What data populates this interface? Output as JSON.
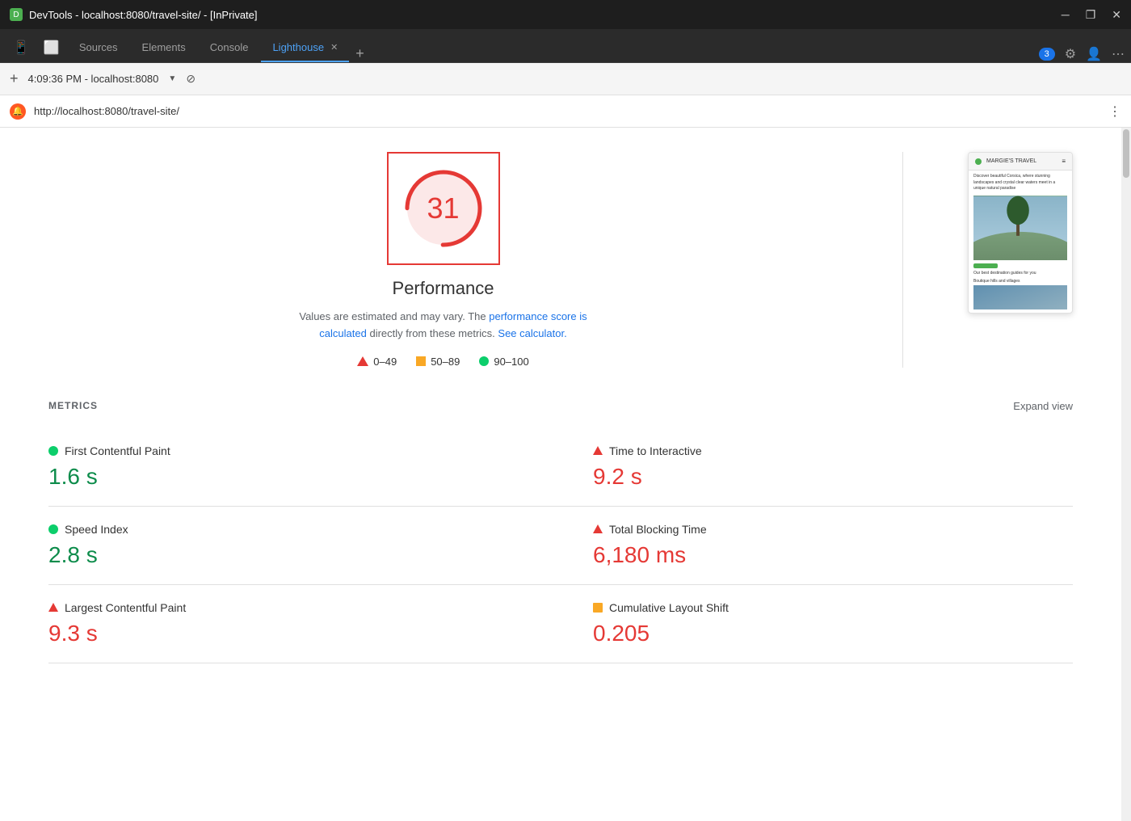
{
  "titleBar": {
    "title": "DevTools - localhost:8080/travel-site/ - [InPrivate]",
    "iconLabel": "D"
  },
  "tabs": {
    "items": [
      {
        "id": "sources",
        "label": "Sources",
        "active": false,
        "closable": false
      },
      {
        "id": "elements",
        "label": "Elements",
        "active": false,
        "closable": false
      },
      {
        "id": "console",
        "label": "Console",
        "active": false,
        "closable": false
      },
      {
        "id": "lighthouse",
        "label": "Lighthouse",
        "active": true,
        "closable": true
      }
    ],
    "notificationCount": "3"
  },
  "topBar": {
    "timestamp": "4:09:36 PM - localhost:8080",
    "plusLabel": "+"
  },
  "urlBar": {
    "url": "http://localhost:8080/travel-site/",
    "iconLabel": "🔔"
  },
  "scorePanel": {
    "score": "31",
    "title": "Performance",
    "description": "Values are estimated and may vary. The",
    "link1": "performance score is calculated",
    "description2": "directly from these metrics.",
    "link2": "See calculator.",
    "legend": [
      {
        "id": "red",
        "range": "0–49"
      },
      {
        "id": "orange",
        "range": "50–89"
      },
      {
        "id": "green",
        "range": "90–100"
      }
    ]
  },
  "screenshot": {
    "title": "MARGIE'S TRAVEL",
    "bodyText1": "Discover beautiful Corsica, where stunning landscapes and crystal clear waters meet in a unique natural paradise",
    "footerText": "Our best destination guides for you",
    "footerText2": "Boutique hills and villages"
  },
  "metrics": {
    "sectionTitle": "METRICS",
    "expandLabel": "Expand view",
    "items": [
      {
        "id": "fcp",
        "indicator": "green",
        "label": "First Contentful Paint",
        "value": "1.6 s",
        "valueColor": "green"
      },
      {
        "id": "tti",
        "indicator": "red",
        "label": "Time to Interactive",
        "value": "9.2 s",
        "valueColor": "red"
      },
      {
        "id": "si",
        "indicator": "green",
        "label": "Speed Index",
        "value": "2.8 s",
        "valueColor": "green"
      },
      {
        "id": "tbt",
        "indicator": "red",
        "label": "Total Blocking Time",
        "value": "6,180 ms",
        "valueColor": "red"
      },
      {
        "id": "lcp",
        "indicator": "red",
        "label": "Largest Contentful Paint",
        "value": "9.3 s",
        "valueColor": "red"
      },
      {
        "id": "cls",
        "indicator": "orange",
        "label": "Cumulative Layout Shift",
        "value": "0.205",
        "valueColor": "red"
      }
    ]
  }
}
